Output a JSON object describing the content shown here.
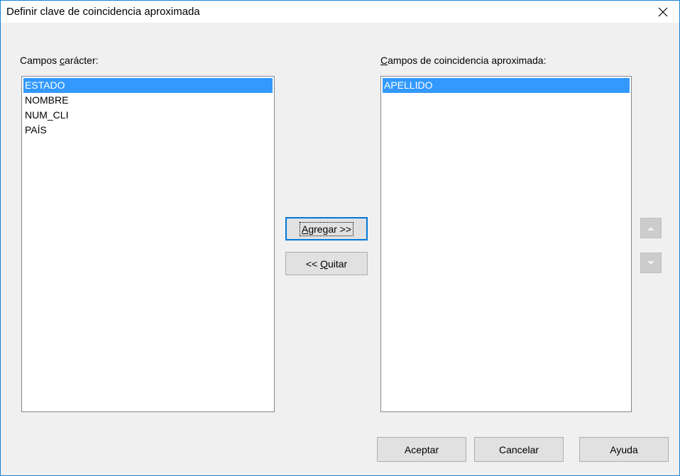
{
  "window": {
    "title": "Definir clave de coincidencia aproximada"
  },
  "left_panel": {
    "label_before": "Campos ",
    "label_hotkey": "c",
    "label_after": "arácter:",
    "items": [
      "ESTADO",
      "NOMBRE",
      "NUM_CLI",
      "PAÍS"
    ],
    "selected_index": 0
  },
  "right_panel": {
    "label_hotkey": "C",
    "label_after": "ampos de coincidencia aproximada:",
    "items": [
      "APELLIDO"
    ],
    "selected_index": 0
  },
  "buttons": {
    "add_hotkey": "A",
    "add_after": "gregar >>",
    "remove_before": "<< ",
    "remove_hotkey": "Q",
    "remove_after": "uitar",
    "ok": "Aceptar",
    "cancel": "Cancelar",
    "help": "Ayuda"
  },
  "icons": {
    "close": "close-icon",
    "move_up": "arrow-up-icon",
    "move_down": "arrow-down-icon"
  },
  "colors": {
    "selection": "#3399ff",
    "focus_border": "#0078d7",
    "window_border": "#1883d7"
  }
}
